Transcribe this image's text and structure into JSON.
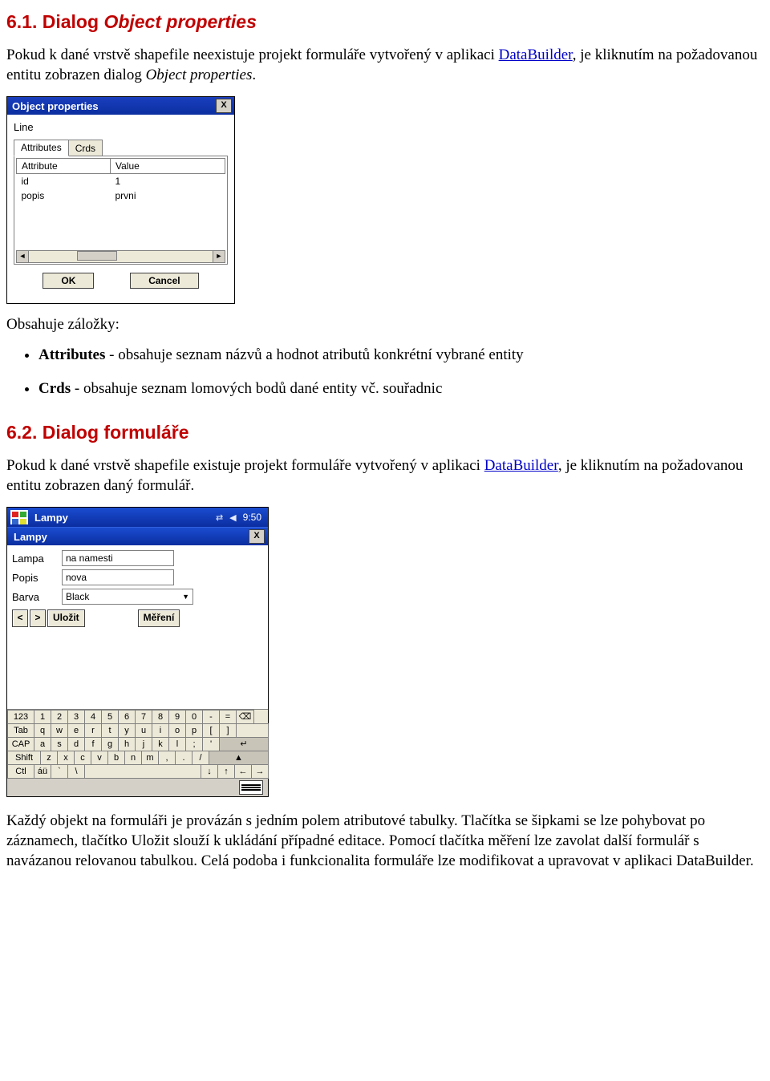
{
  "sections": {
    "s1": {
      "heading_num": "6.1. Dialog ",
      "heading_em": "Object properties",
      "para_1a": "Pokud k dané vrstvě shapefile neexistuje projekt formuláře vytvořený v aplikaci ",
      "link1": "DataBuilder",
      "para_1b": ", je kliknutím na požadovanou entitu zobrazen dialog ",
      "para_1c": "Object properties",
      "para_1d": "."
    },
    "s2": {
      "intro": "Obsahuje záložky:",
      "bullets": [
        {
          "b": "Attributes",
          "t": " - obsahuje seznam názvů a hodnot atributů konkrétní vybrané entity"
        },
        {
          "b": "Crds",
          "t": " - obsahuje seznam lomových bodů dané entity vč. souřadnic"
        }
      ]
    },
    "s3": {
      "heading": "6.2. Dialog formuláře",
      "para_a": "Pokud k dané vrstvě shapefile existuje projekt formuláře vytvořený v aplikaci ",
      "link": "DataBuilder",
      "para_b": ", je kliknutím na požadovanou entitu zobrazen daný formulář."
    },
    "s4": {
      "para": "Každý objekt na formuláři je provázán s jedním polem atributové tabulky. Tlačítka se šipkami se lze pohybovat po záznamech, tlačítko Uložit slouží k ukládání případné editace. Pomocí tlačítka měření lze zavolat další formulář s navázanou relovanou tabulkou. Celá podoba i funkcionalita formuláře lze modifikovat a upravovat v aplikaci DataBuilder."
    }
  },
  "dlg1": {
    "title": "Object properties",
    "close": "X",
    "line": "Line",
    "tabs": {
      "active": "Attributes",
      "inactive": "Crds"
    },
    "columns": [
      "Attribute",
      "Value"
    ],
    "rows": [
      {
        "a": "id",
        "v": "1"
      },
      {
        "a": "popis",
        "v": "prvni"
      }
    ],
    "scroll": {
      "left": "◄",
      "right": "►"
    },
    "buttons": {
      "ok": "OK",
      "cancel": "Cancel"
    }
  },
  "pda": {
    "topbar": {
      "app": "Lampy",
      "clock": "9:50"
    },
    "subtitle": "Lampy",
    "close": "X",
    "fields": [
      {
        "label": "Lampa",
        "value": "na namesti",
        "type": "text"
      },
      {
        "label": "Popis",
        "value": "nova",
        "type": "text"
      },
      {
        "label": "Barva",
        "value": "Black",
        "type": "combo"
      }
    ],
    "nav": {
      "prev": "<",
      "next": ">",
      "save": "Uložit",
      "measure": "Měření"
    },
    "sip": {
      "row0": [
        "123",
        "1",
        "2",
        "3",
        "4",
        "5",
        "6",
        "7",
        "8",
        "9",
        "0",
        "-",
        "="
      ],
      "row1": [
        "Tab",
        "q",
        "w",
        "e",
        "r",
        "t",
        "y",
        "u",
        "i",
        "o",
        "p",
        "[",
        "]"
      ],
      "row2": [
        "CAP",
        "a",
        "s",
        "d",
        "f",
        "g",
        "h",
        "j",
        "k",
        "l",
        ";",
        "'"
      ],
      "row3": [
        "Shift",
        "z",
        "x",
        "c",
        "v",
        "b",
        "n",
        "m",
        ",",
        ".",
        "/"
      ],
      "row4": [
        "Ctl",
        "áü",
        "`",
        "\\",
        " ",
        "↓",
        "↑",
        "←",
        "→"
      ]
    }
  }
}
